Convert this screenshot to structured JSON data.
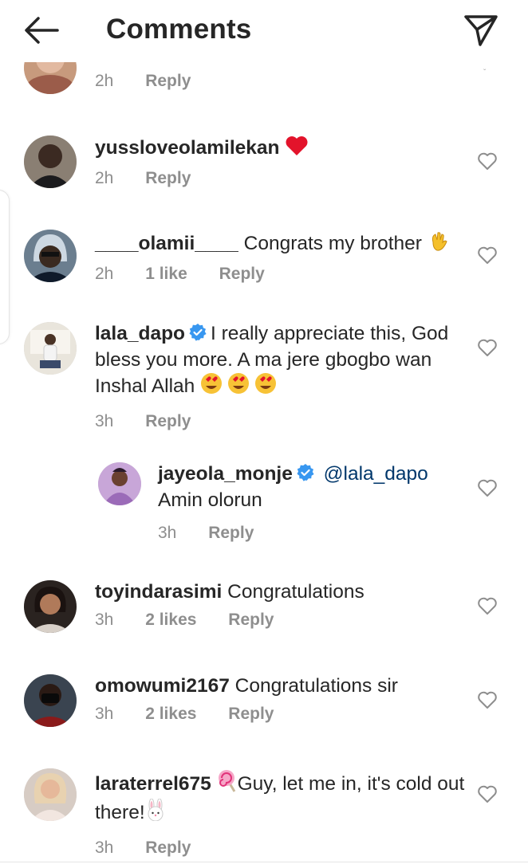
{
  "header": {
    "title": "Comments"
  },
  "partial_comment": {
    "time": "2h",
    "reply": "Reply"
  },
  "comments": [
    {
      "username": "yussloveolamilekan",
      "text": "",
      "time": "2h",
      "likes": "",
      "reply": "Reply"
    },
    {
      "username": "____olamii____",
      "text": "Congrats my brother",
      "time": "2h",
      "likes": "1 like",
      "reply": "Reply"
    },
    {
      "username": "lala_dapo",
      "text": "I really appreciate this, God bless you more. A ma jere gbogbo wan Inshal Allah",
      "time": "3h",
      "likes": "",
      "reply": "Reply",
      "verified": true
    },
    {
      "username": "jayeola_monje",
      "mention": "@lala_dapo",
      "text": "Amin olorun",
      "time": "3h",
      "likes": "",
      "reply": "Reply",
      "verified": true
    },
    {
      "username": "toyindarasimi",
      "text": "Congratulations",
      "time": "3h",
      "likes": "2 likes",
      "reply": "Reply"
    },
    {
      "username": "omowumi2167",
      "text": "Congratulations sir",
      "time": "3h",
      "likes": "2 likes",
      "reply": "Reply"
    },
    {
      "username": "laraterrel675",
      "text_a": "Guy, let me in, it's cold out there!",
      "time": "3h",
      "likes": "",
      "reply": "Reply"
    }
  ],
  "icons": {
    "back": "arrow-left-icon",
    "send": "paper-plane-icon",
    "like": "heart-outline-icon",
    "verified": "verified-badge-icon",
    "heart_emoji": "red-heart-emoji",
    "clap_emoji": "waving-hand-emoji",
    "heart_eyes": "heart-eyes-emoji",
    "lollipop": "lollipop-emoji",
    "rabbit": "rabbit-face-emoji"
  },
  "colors": {
    "text": "#262626",
    "meta": "#8e8e8e",
    "mention": "#00376b",
    "verified": "#3897f0"
  }
}
